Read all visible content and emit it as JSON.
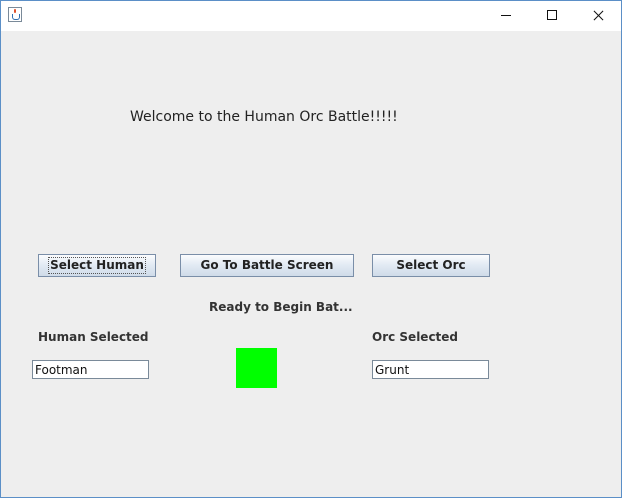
{
  "titlebar": {
    "icon": "java-cup-icon"
  },
  "main": {
    "welcome_text": "Welcome to the Human Orc Battle!!!!!",
    "buttons": {
      "select_human": "Select Human",
      "go_to_battle": "Go To Battle Screen",
      "select_orc": "Select Orc"
    },
    "status_text": "Ready to Begin Bat...",
    "human_label": "Human Selected",
    "human_value": "Footman",
    "orc_label": "Orc Selected",
    "orc_value": "Grunt",
    "indicator_color": "#00ff00"
  }
}
